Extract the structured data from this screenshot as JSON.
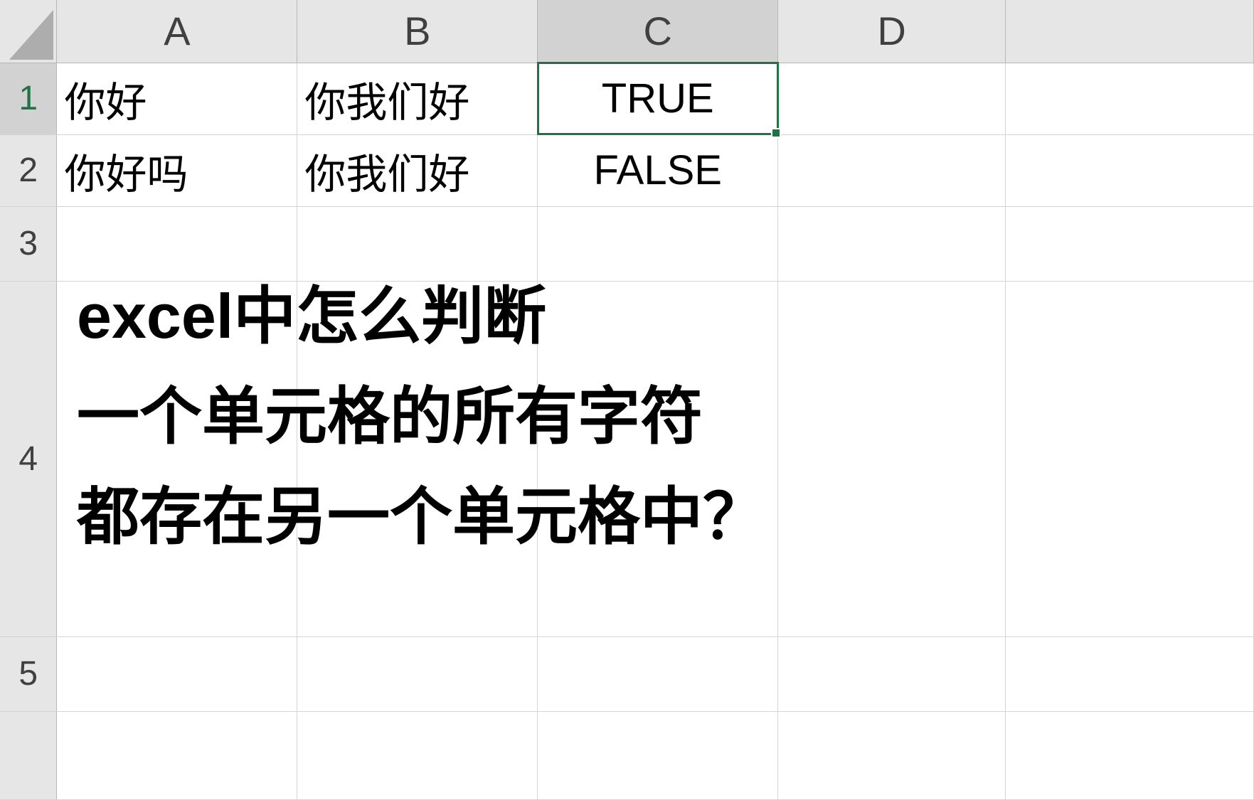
{
  "columns": [
    "A",
    "B",
    "C",
    "D"
  ],
  "rowHeaders": [
    "1",
    "2",
    "3",
    "4",
    "5"
  ],
  "cells": {
    "A1": "你好",
    "B1": "你我们好",
    "C1": "TRUE",
    "A2": "你好吗",
    "B2": "你我们好",
    "C2": "FALSE"
  },
  "selectedCell": "C1",
  "overlayText": {
    "line1": "excel中怎么判断",
    "line2": "一个单元格的所有字符",
    "line3": "都存在另一个单元格中？"
  }
}
